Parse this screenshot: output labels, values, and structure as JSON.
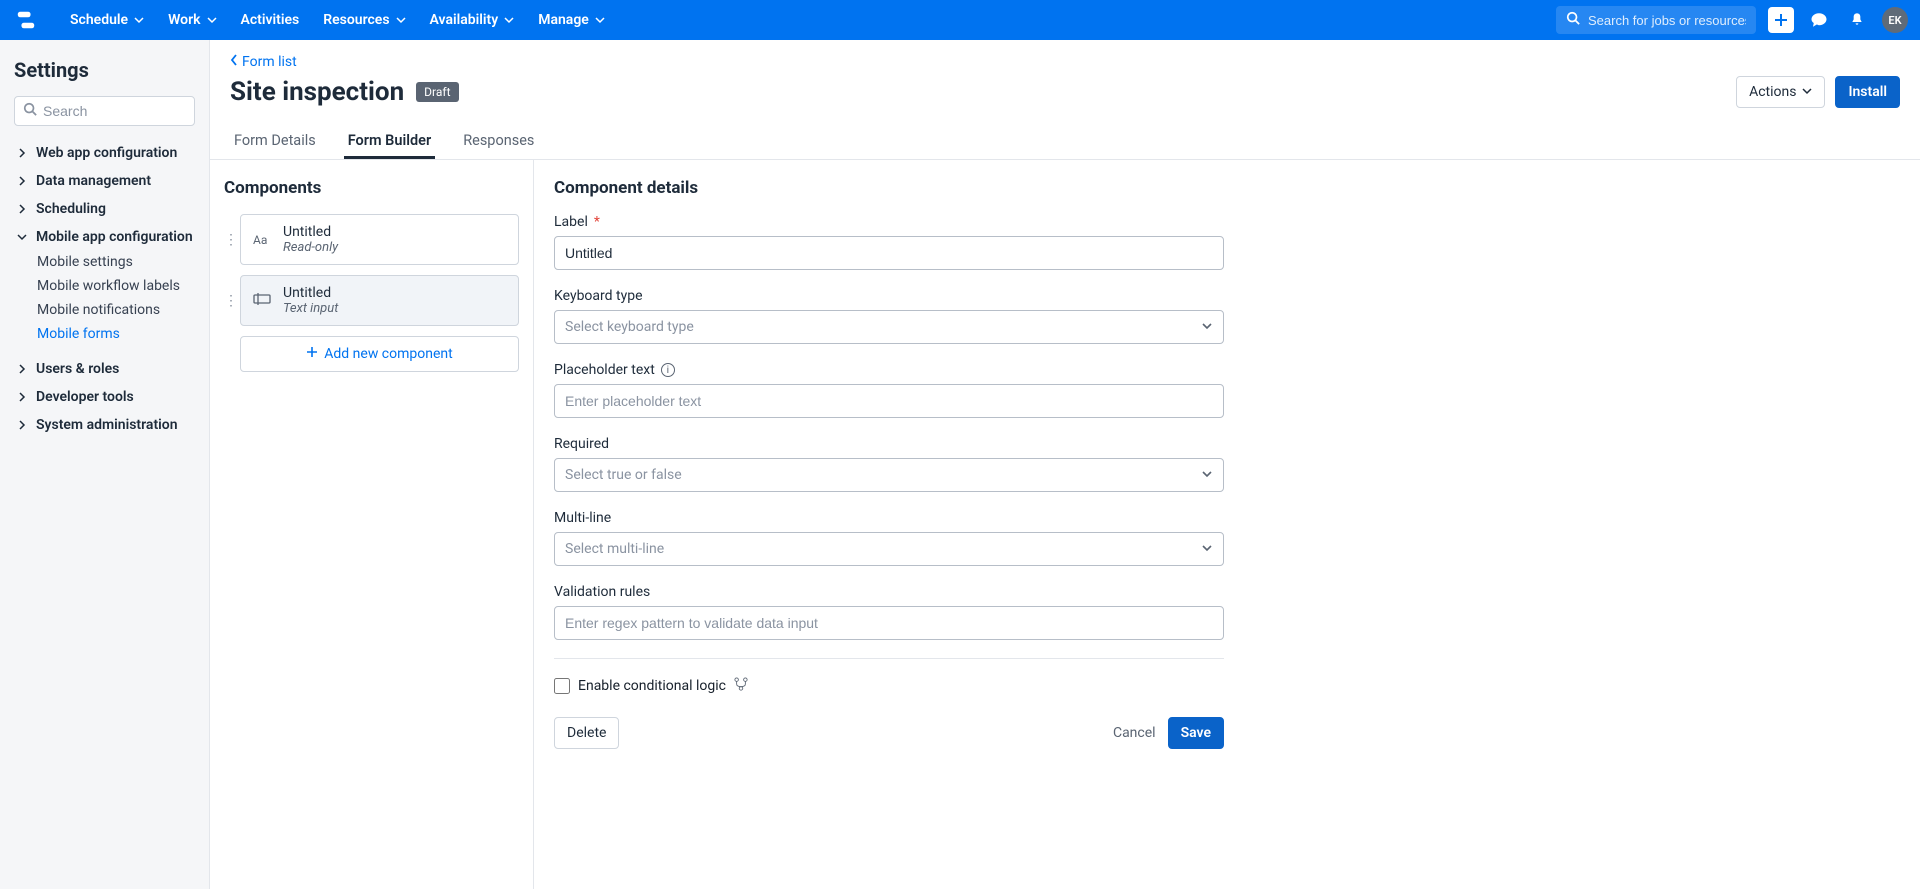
{
  "nav": {
    "items": [
      "Schedule",
      "Work",
      "Activities",
      "Resources",
      "Availability",
      "Manage"
    ],
    "search_placeholder": "Search for jobs or resources",
    "avatar": "EK"
  },
  "sidebar": {
    "title": "Settings",
    "search_placeholder": "Search",
    "groups": {
      "webapp": "Web app configuration",
      "datamgmt": "Data management",
      "scheduling": "Scheduling",
      "mobile": "Mobile app configuration",
      "users": "Users & roles",
      "dev": "Developer tools",
      "sysadmin": "System administration"
    },
    "mobile_sub": {
      "settings": "Mobile settings",
      "workflow": "Mobile workflow labels",
      "notifications": "Mobile notifications",
      "forms": "Mobile forms"
    }
  },
  "page": {
    "breadcrumb": "Form list",
    "title": "Site inspection",
    "badge": "Draft",
    "actions_btn": "Actions",
    "install_btn": "Install",
    "tabs": {
      "details": "Form Details",
      "builder": "Form Builder",
      "responses": "Responses"
    }
  },
  "components": {
    "title": "Components",
    "items": [
      {
        "title": "Untitled",
        "sub": "Read-only",
        "icon": "Aa"
      },
      {
        "title": "Untitled",
        "sub": "Text input",
        "icon": "txt"
      }
    ],
    "add": "Add new component"
  },
  "details": {
    "title": "Component details",
    "label_field": "Label",
    "label_value": "Untitled",
    "keyboard_label": "Keyboard type",
    "keyboard_placeholder": "Select keyboard type",
    "placeholder_label": "Placeholder text",
    "placeholder_placeholder": "Enter placeholder text",
    "required_label": "Required",
    "required_placeholder": "Select true or false",
    "multiline_label": "Multi-line",
    "multiline_placeholder": "Select multi-line",
    "validation_label": "Validation rules",
    "validation_placeholder": "Enter regex pattern to validate data input",
    "conditional": "Enable conditional logic",
    "delete": "Delete",
    "cancel": "Cancel",
    "save": "Save"
  }
}
